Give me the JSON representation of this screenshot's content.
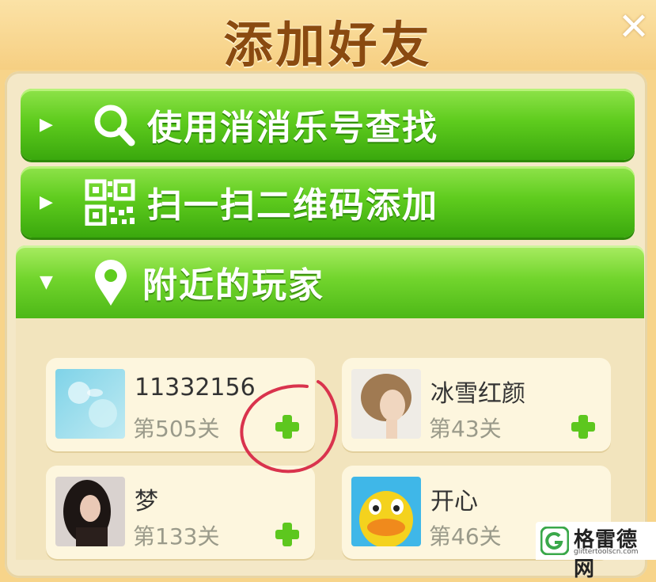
{
  "title": "添加好友",
  "close_icon": "close-icon",
  "menu": [
    {
      "label": "使用消消乐号查找",
      "icon": "search-icon"
    },
    {
      "label": "扫一扫二维码添加",
      "icon": "qrcode-icon"
    }
  ],
  "nearby": {
    "label": "附近的玩家",
    "icon": "location-pin-icon"
  },
  "players": [
    {
      "name": "11332156",
      "level": "第505关"
    },
    {
      "name": "冰雪红颜",
      "level": "第43关"
    },
    {
      "name": "梦",
      "level": "第133关"
    },
    {
      "name": "开心",
      "level": "第46关"
    }
  ],
  "watermark": {
    "text": "格雷德网",
    "sub": "glittertoolscn.com"
  },
  "colors": {
    "accent_green": "#5fcc1e",
    "title_brown": "#8a4a10",
    "annotation_red": "#d9334d"
  }
}
